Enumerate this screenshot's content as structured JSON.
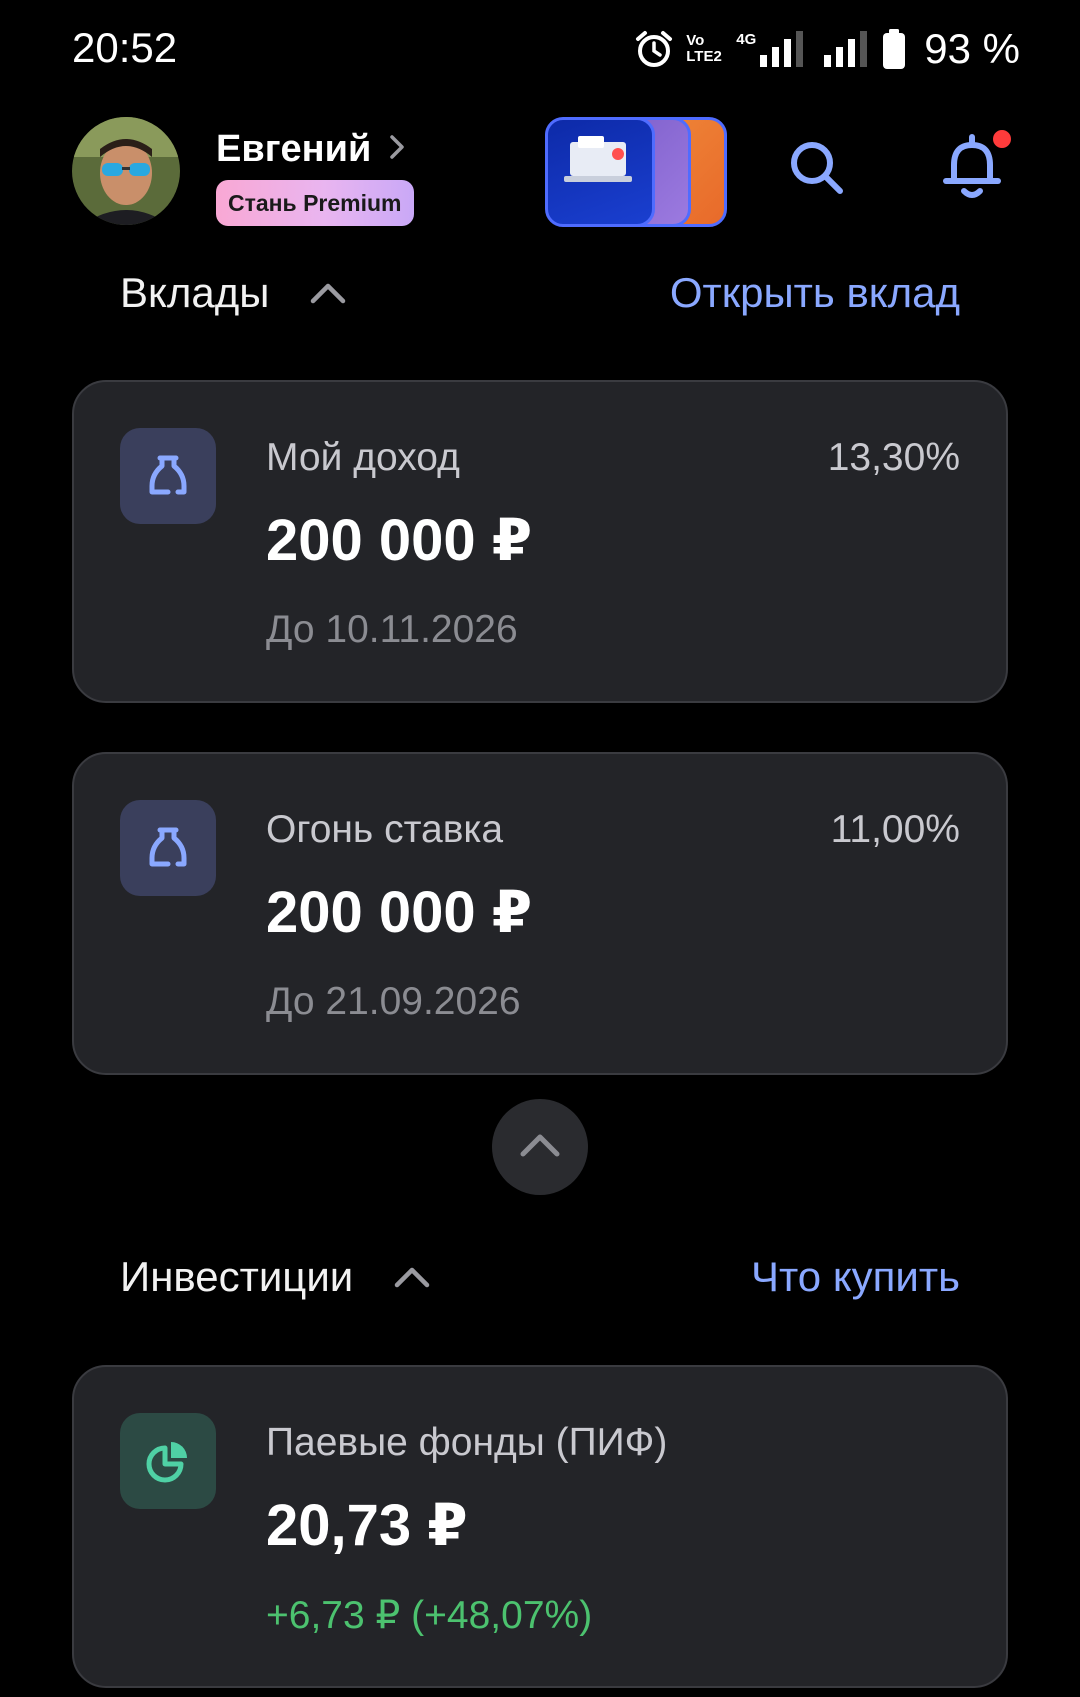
{
  "status_bar": {
    "time": "20:52",
    "battery_percent": "93 %",
    "network_label": "4G",
    "volte_label": "Vo LTE2"
  },
  "header": {
    "user_name": "Евгений",
    "premium_label": "Стань Premium",
    "stories_icon": "stories-thumbnails",
    "search_icon": "search-icon",
    "notification_icon": "bell-icon",
    "notification_dot_color": "#ff3b3b"
  },
  "deposits": {
    "title": "Вклады",
    "action": "Открыть вклад",
    "items": [
      {
        "name": "Мой доход",
        "rate": "13,30%",
        "amount": "200 000 ₽",
        "until": "До 10.11.2026",
        "icon": "deposit-jar-icon"
      },
      {
        "name": "Огонь ставка",
        "rate": "11,00%",
        "amount": "200 000 ₽",
        "until": "До 21.09.2026",
        "icon": "deposit-jar-icon"
      }
    ]
  },
  "investments": {
    "title": "Инвестиции",
    "action": "Что купить",
    "items": [
      {
        "name": "Паевые фонды (ПИФ)",
        "amount": "20,73 ₽",
        "change": "+6,73 ₽ (+48,07%)",
        "icon": "pie-chart-icon"
      }
    ]
  },
  "colors": {
    "background": "#000000",
    "card": "#232428",
    "accent": "#8aa8ff",
    "positive": "#4cc26f",
    "muted": "#8b8c92"
  }
}
